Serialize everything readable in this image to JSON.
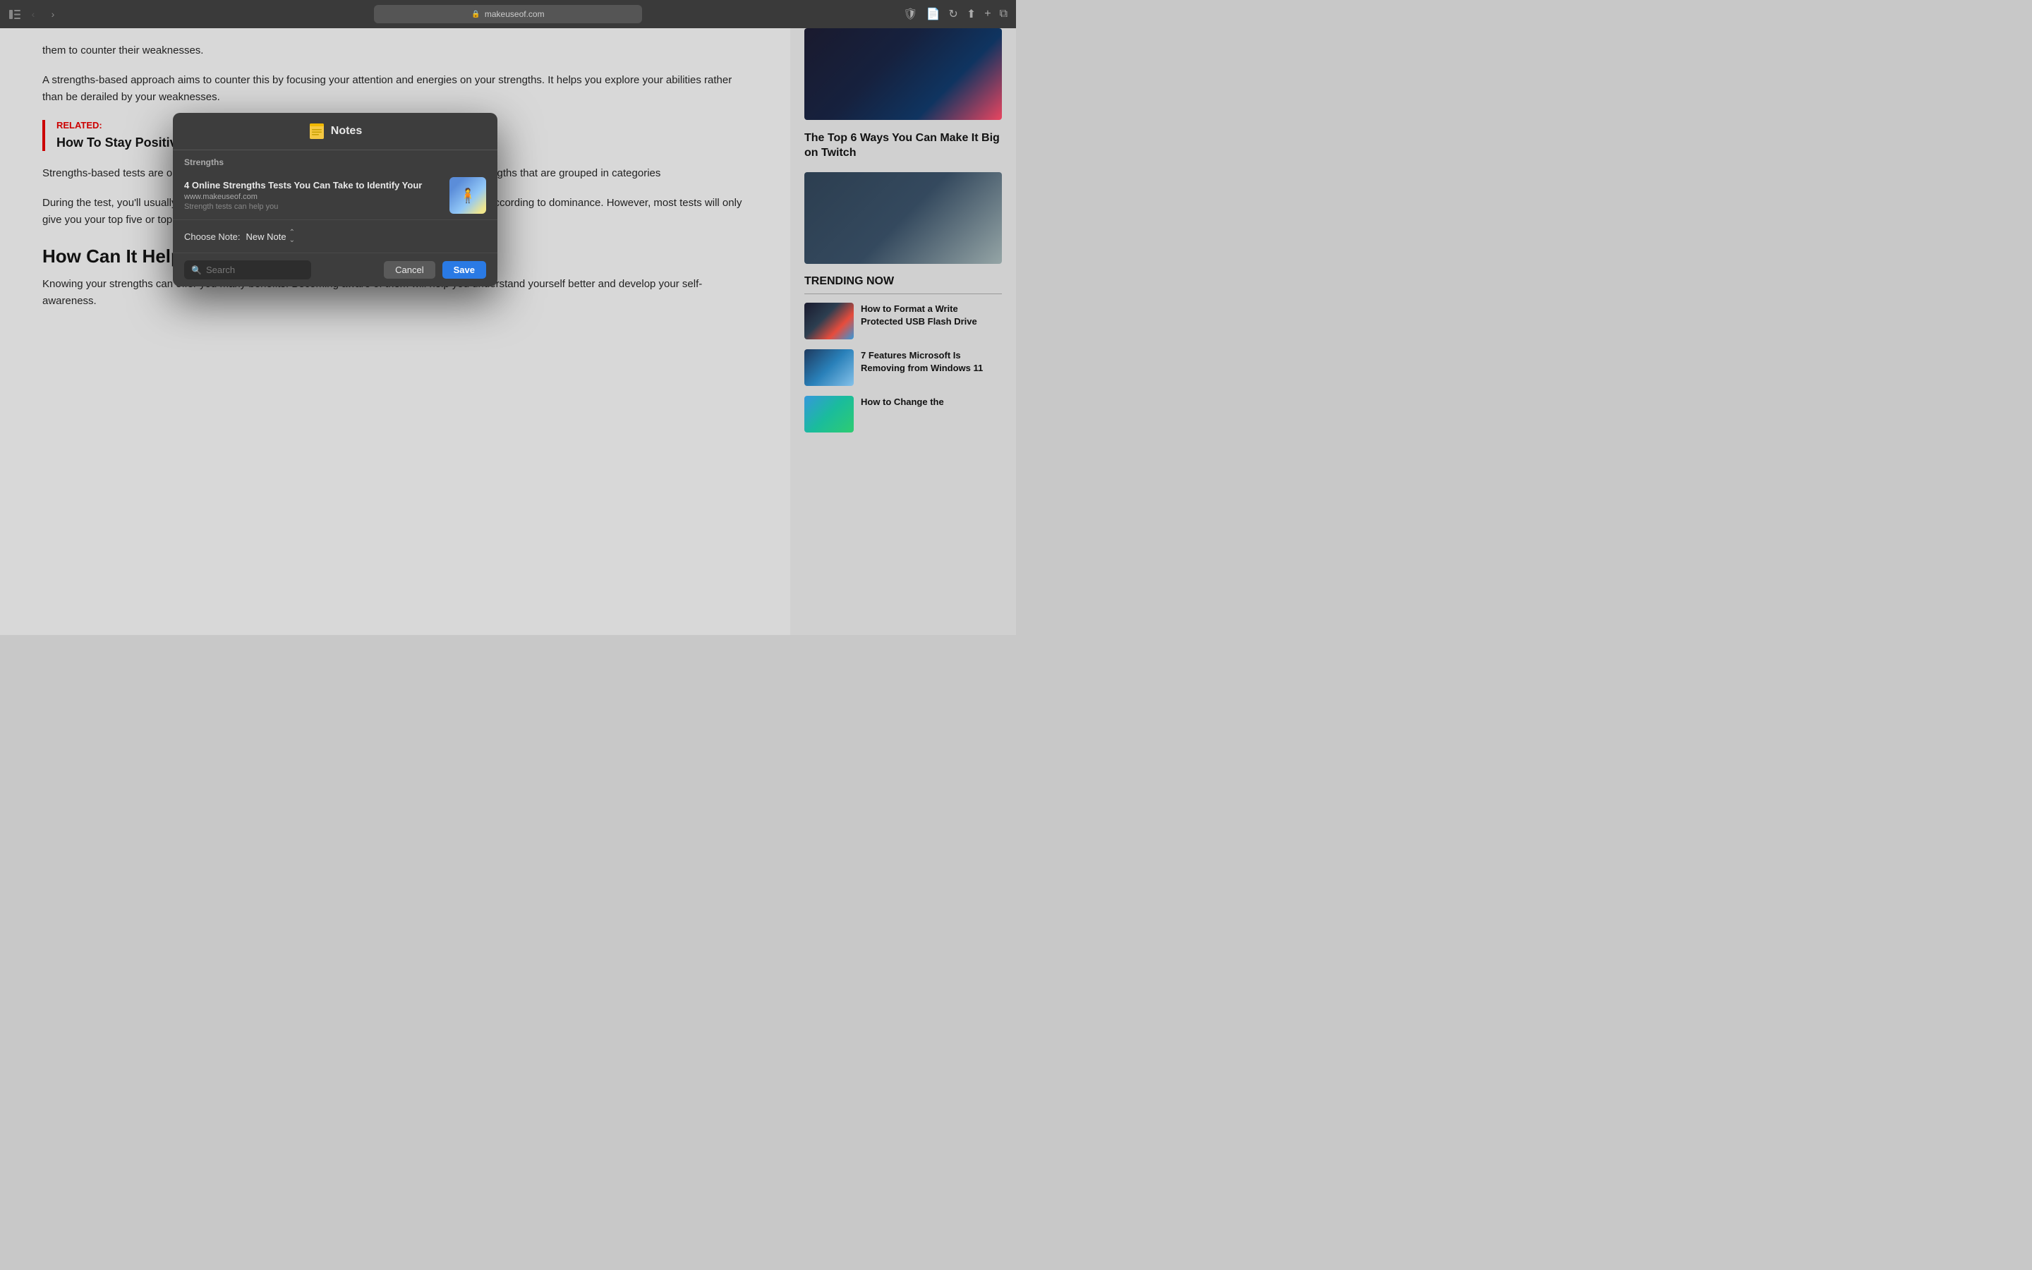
{
  "browser": {
    "url": "makeuseof.com",
    "reload_title": "Reload Page"
  },
  "article": {
    "paragraph1": "them to counter their weaknesses.",
    "paragraph2": "A strengths-based approach aims to counter this by focusing your attention and energies on your strengths. It helps you explore your abilities rather than be derailed by your weaknesses.",
    "related_label": "RELATED:",
    "related_link": "How To Stay Positive Online And Improve Mental Health With Apps",
    "paragraph3": "Strengths-based tests are online assessments of how you usually think, behave, and feel. A strengths that are grouped in categories",
    "paragraph4": "During the test, you'll usually be shown a one that best describes you. Then, the as them down according to dominance. However, most tests will only give you your top five or top 10 strengths.",
    "section_heading": "How Can It Help Me?",
    "paragraph5": "Knowing your strengths can offer you many benefits. Becoming aware of them will help you understand yourself better and develop your self-awareness."
  },
  "sidebar": {
    "article1_title": "The Top 6 Ways You Can Make It Big on Twitch",
    "trending_heading": "TRENDING NOW",
    "trending_items": [
      {
        "title": "How to Format a Write Protected USB Flash Drive",
        "img_class": "img-usb"
      },
      {
        "title": "7 Features Microsoft Is Removing from Windows 11",
        "img_class": "img-windows"
      },
      {
        "title": "How to Change the",
        "img_class": "img-thumbnail"
      }
    ]
  },
  "dialog": {
    "title": "Notes",
    "folder_label": "Strengths",
    "note": {
      "title": "4 Online Strengths Tests You Can Take to Identify Your",
      "url": "www.makeuseof.com",
      "preview": "Strength tests can help you"
    },
    "choose_note_label": "Choose Note:",
    "choose_note_value": "New Note",
    "search_placeholder": "Search",
    "cancel_label": "Cancel",
    "save_label": "Save"
  }
}
